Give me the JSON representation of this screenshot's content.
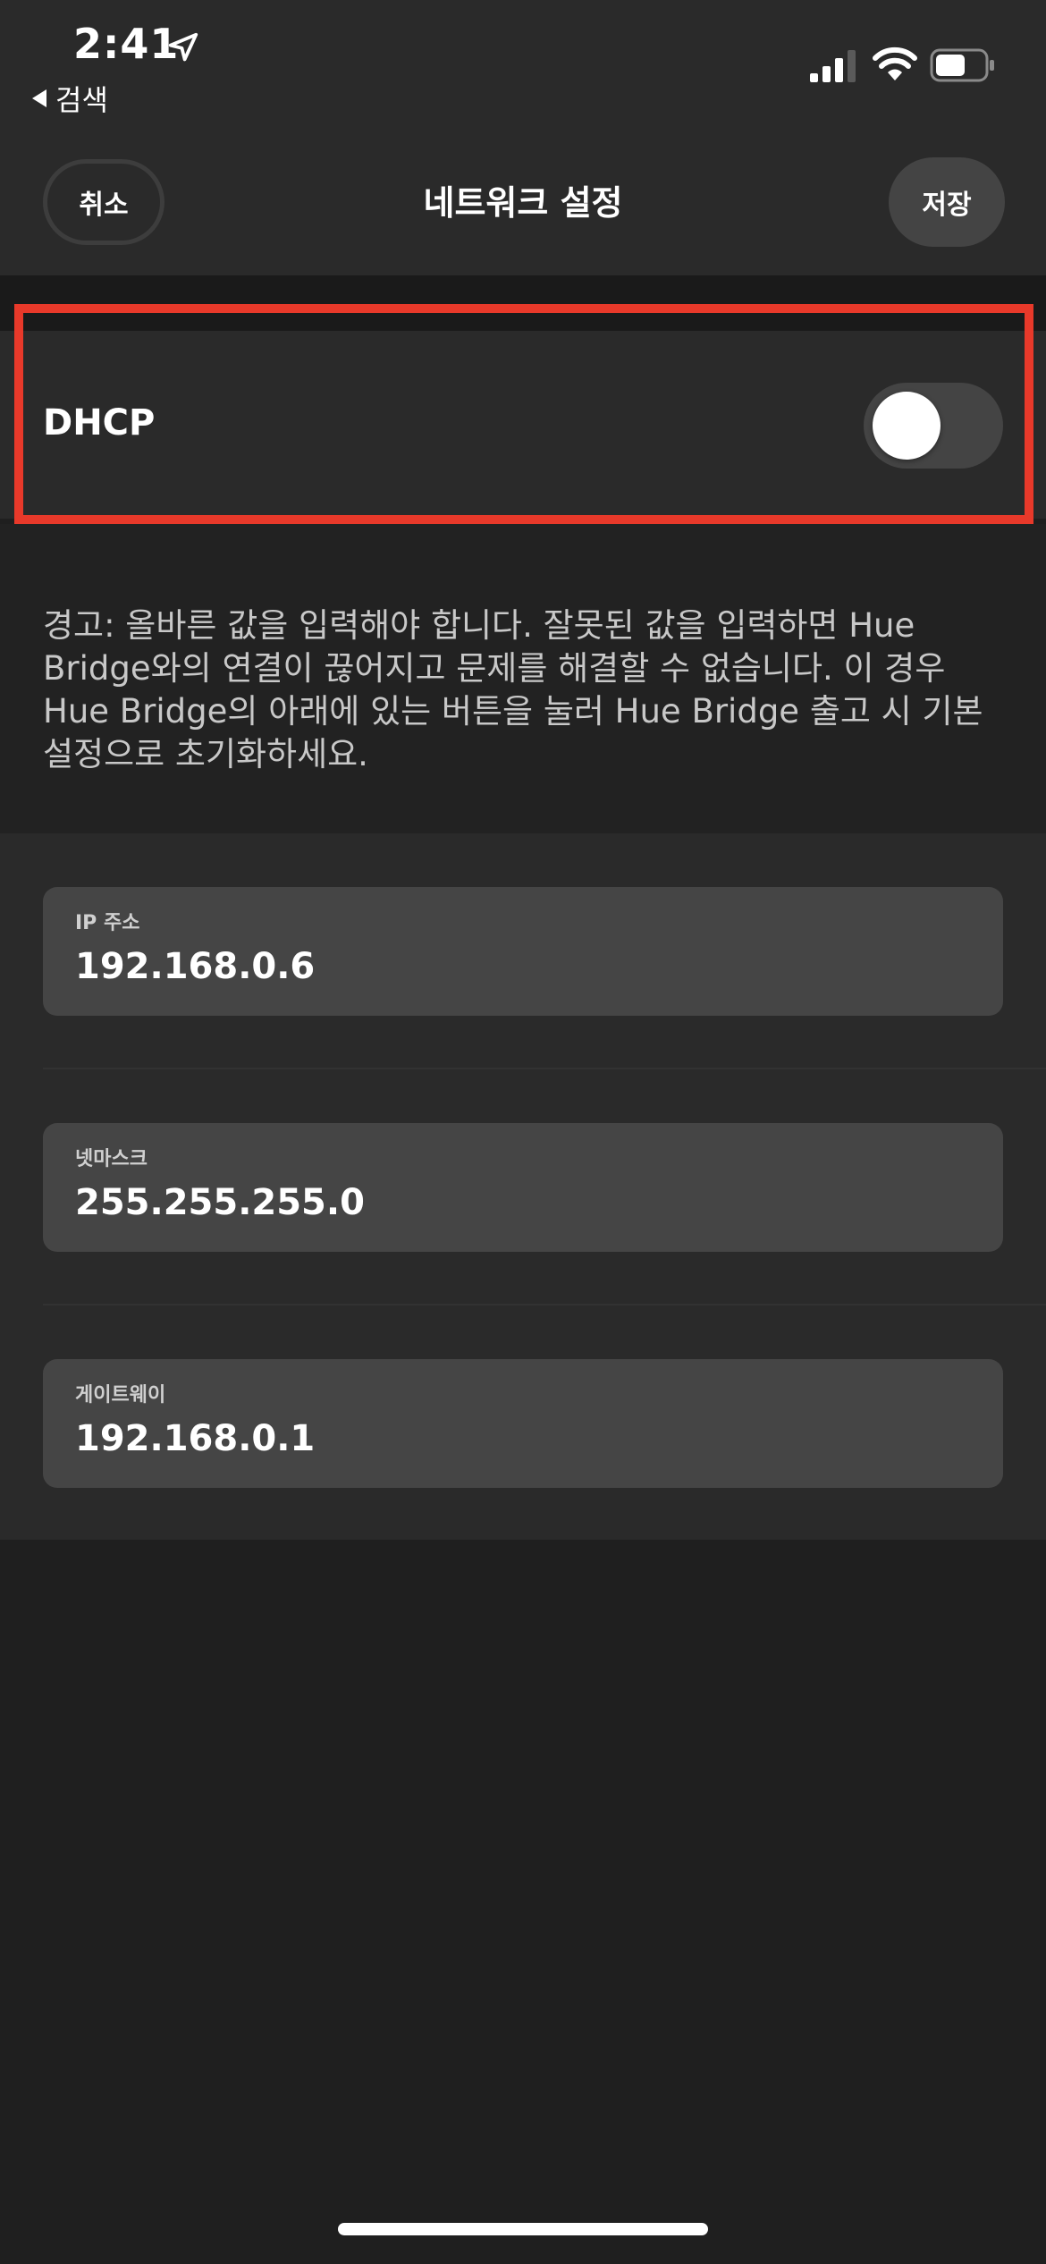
{
  "status_bar": {
    "time": "2:41",
    "back_to_app": "검색",
    "icons": [
      "location-arrow-icon",
      "cellular-signal-icon",
      "wifi-icon",
      "battery-icon"
    ]
  },
  "nav": {
    "cancel_label": "취소",
    "title": "네트워크 설정",
    "save_label": "저장"
  },
  "dhcp": {
    "label": "DHCP",
    "enabled": false
  },
  "warning": "경고: 올바른 값을 입력해야 합니다. 잘못된 값을 입력하면 Hue Bridge와의 연결이 끊어지고 문제를 해결할 수 없습니다. 이 경우 Hue Bridge의 아래에 있는 버튼을 눌러 Hue Bridge 출고 시 기본 설정으로 초기화하세요.",
  "fields": [
    {
      "label": "IP 주소",
      "value": "192.168.0.6"
    },
    {
      "label": "넷마스크",
      "value": "255.255.255.0"
    },
    {
      "label": "게이트웨이",
      "value": "192.168.0.1"
    }
  ],
  "colors": {
    "background": "#1f1f1f",
    "surface": "#2a2a2a",
    "field": "#454545",
    "highlight": "#e8392a"
  }
}
